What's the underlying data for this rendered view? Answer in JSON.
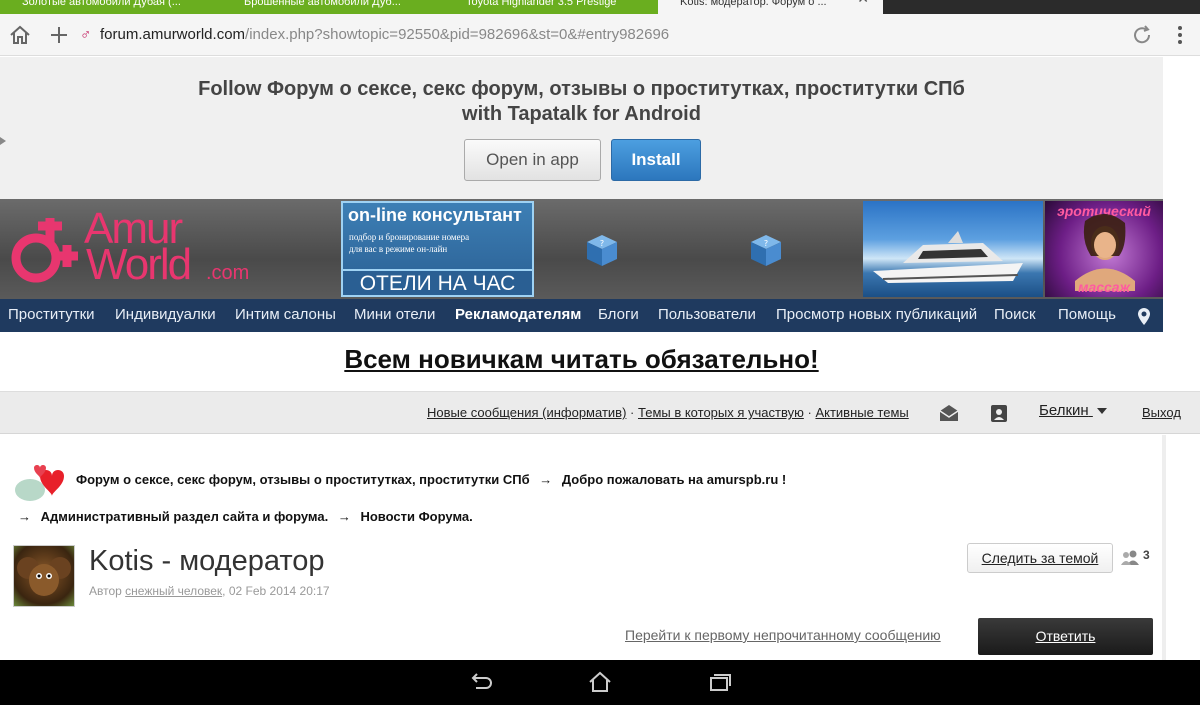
{
  "browser": {
    "tabs": [
      {
        "label": "Золотые автомобили Дубая (..."
      },
      {
        "label": "Брошенные автомобили Дуб..."
      },
      {
        "label": "Toyota Highlander 3.5 Prestige"
      },
      {
        "label": "Kotis: модератор. Форум о ..."
      }
    ],
    "url_host": "forum.amurworld.com",
    "url_path": "/index.php?showtopic=92550&pid=982696&st=0&#entry982696"
  },
  "tapatalk": {
    "title_line1": "Follow Форум о сексе, секс форум, отзывы о проститутках, проститутки СПб",
    "title_line2": "with Tapatalk for Android",
    "open_label": "Open in app",
    "install_label": "Install"
  },
  "header": {
    "logo_amur": "Amur",
    "logo_world": "World",
    "logo_com": ".com",
    "consult_title": "on-line консультант",
    "consult_sub1": "подбор и бронирование номера",
    "consult_sub2": "для вас в режиме он-лайн",
    "consult_hotels": "ОТЕЛИ НА ЧАС",
    "massage_top": "эротический",
    "massage_bottom": "массаж"
  },
  "nav": {
    "items": [
      {
        "label": "Проститутки"
      },
      {
        "label": "Индивидуалки"
      },
      {
        "label": "Интим салоны"
      },
      {
        "label": "Мини отели"
      },
      {
        "label": "Рекламодателям"
      },
      {
        "label": "Блоги"
      },
      {
        "label": "Пользователи"
      },
      {
        "label": "Просмотр новых публикаций"
      },
      {
        "label": "Поиск"
      },
      {
        "label": "Помощь"
      }
    ]
  },
  "announcement": "Всем новичкам читать обязательно!",
  "userbar": {
    "new_messages": "Новые сообщения (информатив)",
    "sep": "·",
    "my_topics": "Темы в которых я участвую",
    "active_topics": "Активные темы",
    "username": "Белкин",
    "logout": "Выход"
  },
  "breadcrumb": {
    "arrow": "→",
    "items": [
      "Форум о сексе, секс форум, отзывы о проститутках, проститутки СПб",
      "Добро пожаловать на amurspb.ru !",
      "Административный раздел сайта и форума.",
      "Новости Форума."
    ]
  },
  "topic": {
    "title": "Kotis - модератор",
    "meta_prefix": "Автор",
    "author": "снежный человек",
    "meta_date": ", 02 Feb 2014 20:17",
    "follow_label": "Следить за темой",
    "follow_count": "3",
    "unread_link": "Перейти к первому непрочитанному сообщению",
    "reply_label": "Ответить"
  },
  "colors": {
    "nav_bg": "#1f3a5f",
    "brand_pink": "#e8366f",
    "install_blue": "#2c77bd",
    "tab_green": "#6aae1f"
  }
}
